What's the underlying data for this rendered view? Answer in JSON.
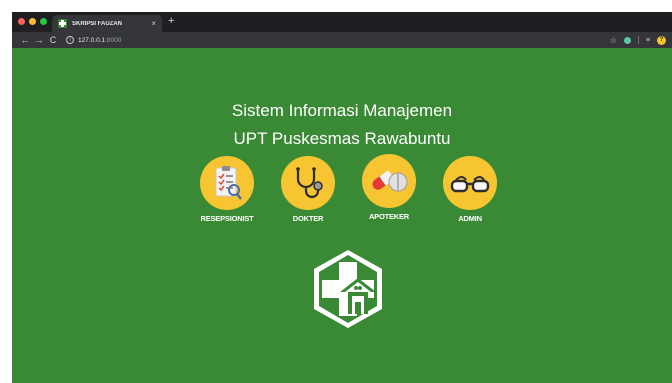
{
  "browser": {
    "tab": {
      "title": "SKRIPSI FAUZAN",
      "close_icon": "×",
      "new_tab_icon": "+"
    },
    "url": {
      "host": "127.0.0.1",
      "port": ":8000"
    },
    "traffic_lights": [
      "#ff5f57",
      "#febc2e",
      "#28c840"
    ],
    "nav": {
      "back": "←",
      "forward": "→",
      "reload": "C"
    },
    "info_icon": "i",
    "bookmark_icon": "☆",
    "queue_icon": "≡",
    "profile_icon": "?"
  },
  "page": {
    "background": "#3a8a35",
    "title_line1": "Sistem Informasi Manajemen",
    "title_line2": "UPT Puskesmas Rawabuntu",
    "roles": [
      {
        "label": "RESEPSIONIST",
        "icon": "clipboard-checklist-icon"
      },
      {
        "label": "DOKTER",
        "icon": "stethoscope-icon"
      },
      {
        "label": "APOTEKER",
        "icon": "pill-capsule-icon"
      },
      {
        "label": "ADMIN",
        "icon": "glasses-icon"
      }
    ],
    "role_circle_color": "#f7c531",
    "logo_icon": "puskesmas-logo-icon"
  }
}
